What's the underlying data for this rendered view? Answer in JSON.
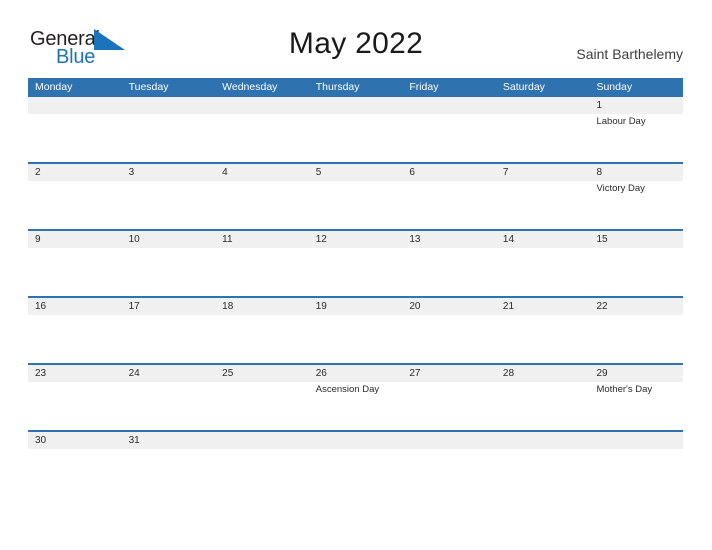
{
  "brand": {
    "name_part1": "General",
    "name_part2": "Blue",
    "flag_icon": "blue-triangle-flag-icon",
    "color_dark": "#231f20",
    "color_blue": "#1b73bb"
  },
  "header": {
    "title": "May 2022",
    "region": "Saint Barthelemy"
  },
  "theme": {
    "header_blue": "#2e72b0",
    "row_rule_blue": "#2e72b0",
    "date_band_gray": "#f0f0f0",
    "page_background": "#ffffff",
    "text_color": "#2a2a2a"
  },
  "calendar": {
    "day_headers": [
      "Monday",
      "Tuesday",
      "Wednesday",
      "Thursday",
      "Friday",
      "Saturday",
      "Sunday"
    ],
    "weeks": [
      {
        "short": false,
        "days": [
          {
            "date": "",
            "events": []
          },
          {
            "date": "",
            "events": []
          },
          {
            "date": "",
            "events": []
          },
          {
            "date": "",
            "events": []
          },
          {
            "date": "",
            "events": []
          },
          {
            "date": "",
            "events": []
          },
          {
            "date": "1",
            "events": [
              "Labour Day"
            ]
          }
        ]
      },
      {
        "short": false,
        "days": [
          {
            "date": "2",
            "events": []
          },
          {
            "date": "3",
            "events": []
          },
          {
            "date": "4",
            "events": []
          },
          {
            "date": "5",
            "events": []
          },
          {
            "date": "6",
            "events": []
          },
          {
            "date": "7",
            "events": []
          },
          {
            "date": "8",
            "events": [
              "Victory Day"
            ]
          }
        ]
      },
      {
        "short": false,
        "days": [
          {
            "date": "9",
            "events": []
          },
          {
            "date": "10",
            "events": []
          },
          {
            "date": "11",
            "events": []
          },
          {
            "date": "12",
            "events": []
          },
          {
            "date": "13",
            "events": []
          },
          {
            "date": "14",
            "events": []
          },
          {
            "date": "15",
            "events": []
          }
        ]
      },
      {
        "short": false,
        "days": [
          {
            "date": "16",
            "events": []
          },
          {
            "date": "17",
            "events": []
          },
          {
            "date": "18",
            "events": []
          },
          {
            "date": "19",
            "events": []
          },
          {
            "date": "20",
            "events": []
          },
          {
            "date": "21",
            "events": []
          },
          {
            "date": "22",
            "events": []
          }
        ]
      },
      {
        "short": false,
        "days": [
          {
            "date": "23",
            "events": []
          },
          {
            "date": "24",
            "events": []
          },
          {
            "date": "25",
            "events": []
          },
          {
            "date": "26",
            "events": [
              "Ascension Day"
            ]
          },
          {
            "date": "27",
            "events": []
          },
          {
            "date": "28",
            "events": []
          },
          {
            "date": "29",
            "events": [
              "Mother's Day"
            ]
          }
        ]
      },
      {
        "short": true,
        "days": [
          {
            "date": "30",
            "events": []
          },
          {
            "date": "31",
            "events": []
          },
          {
            "date": "",
            "events": []
          },
          {
            "date": "",
            "events": []
          },
          {
            "date": "",
            "events": []
          },
          {
            "date": "",
            "events": []
          },
          {
            "date": "",
            "events": []
          }
        ]
      }
    ]
  }
}
